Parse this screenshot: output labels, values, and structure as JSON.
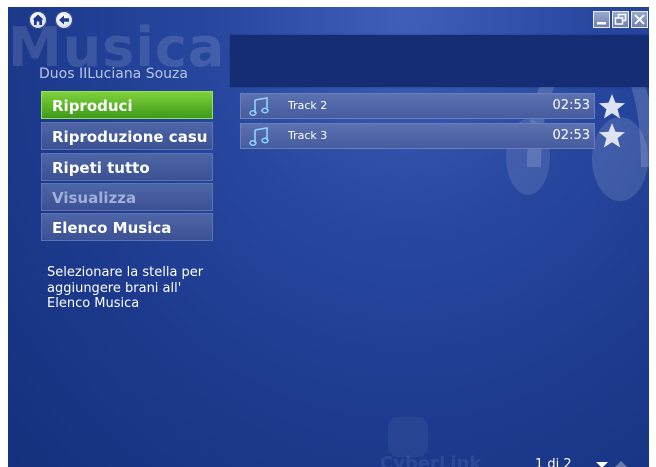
{
  "app": {
    "watermark_title": "Musica",
    "artist": "Duos IILuciana Souza",
    "brand_watermark": "CyberLink"
  },
  "menu": {
    "items": [
      {
        "label": "Riproduci",
        "state": "active"
      },
      {
        "label": "Riproduzione casu",
        "state": "normal"
      },
      {
        "label": "Ripeti tutto",
        "state": "normal"
      },
      {
        "label": "Visualizza",
        "state": "disabled"
      },
      {
        "label": "Elenco Musica",
        "state": "normal"
      }
    ]
  },
  "hint": "Selezionare la stella per aggiungere brani all' Elenco Musica",
  "tracks": [
    {
      "name": "Track 2",
      "duration": "02:53",
      "icon": "music-note-icon"
    },
    {
      "name": "Track 3",
      "duration": "02:53",
      "icon": "music-note-icon"
    }
  ],
  "pagination": {
    "text": "1 di 2"
  },
  "colors": {
    "background": "#1d3a8e",
    "active_menu": "#5cb82a",
    "menu": "#4a5f9f",
    "track_row": "#5168a8",
    "title_bar": "#142d74"
  }
}
